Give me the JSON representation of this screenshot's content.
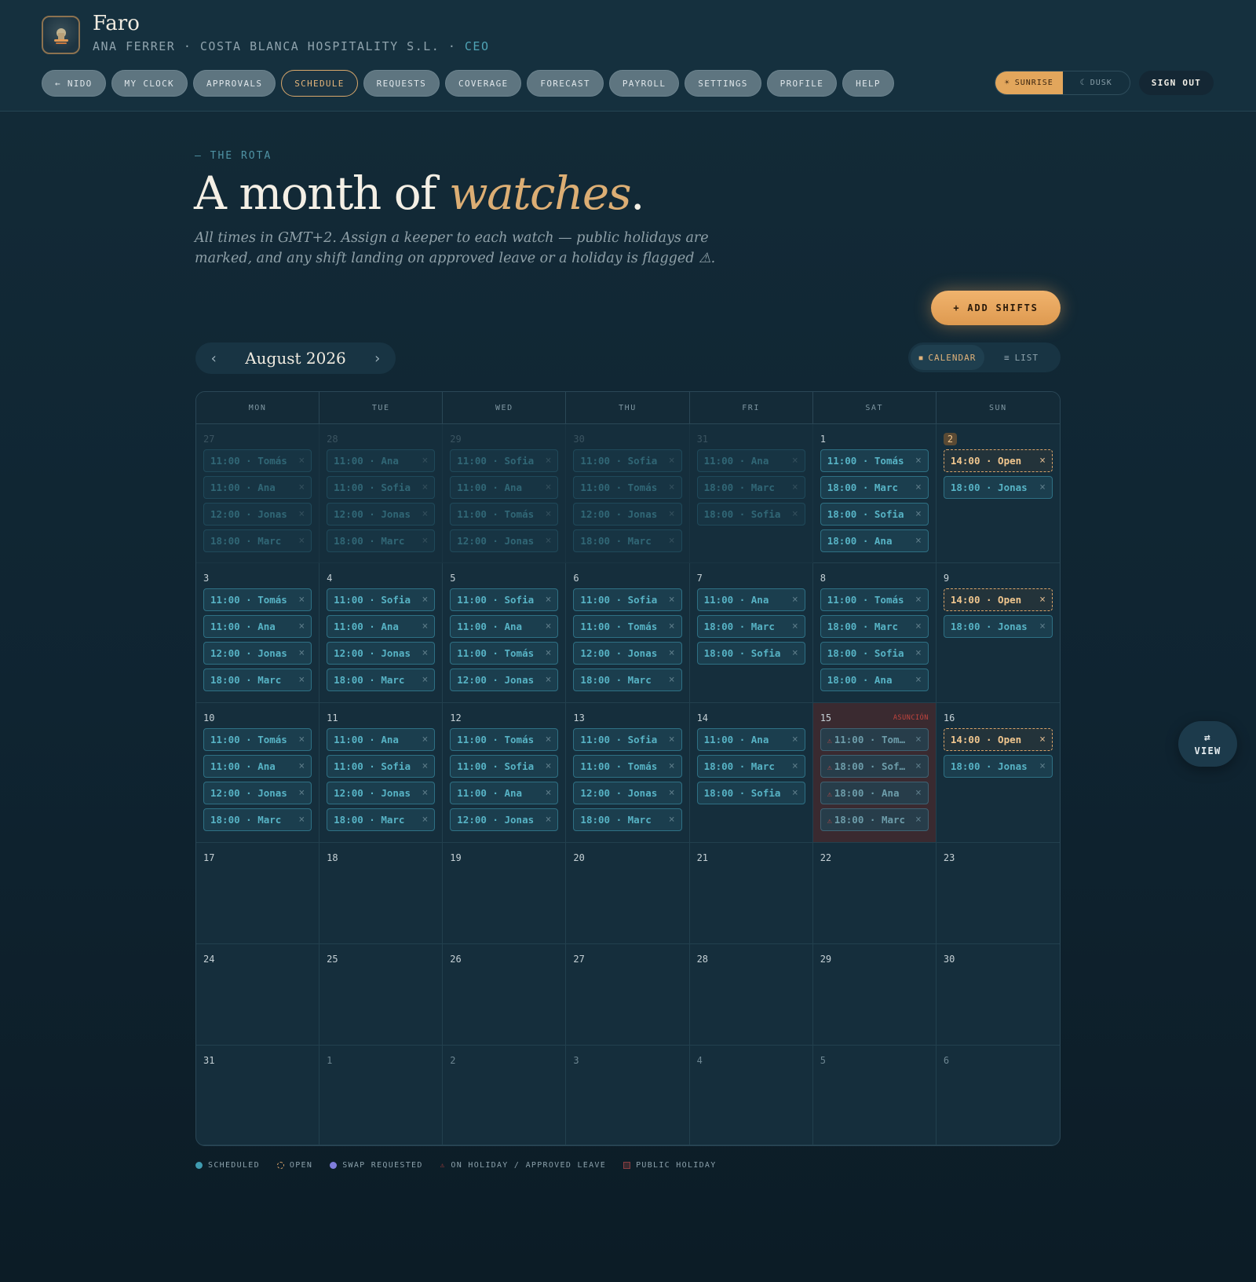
{
  "brand": {
    "name": "Faro",
    "user": "ANA FERRER · COSTA BLANCA HOSPITALITY S.L. · ",
    "role": "CEO"
  },
  "nav": [
    "← NIDO",
    "MY CLOCK",
    "APPROVALS",
    "SCHEDULE",
    "REQUESTS",
    "COVERAGE",
    "FORECAST",
    "PAYROLL",
    "SETTINGS",
    "PROFILE",
    "HELP"
  ],
  "nav_active": "SCHEDULE",
  "theme": {
    "sunrise": "SUNRISE",
    "dusk": "DUSK",
    "active": "sunrise"
  },
  "signout": "SIGN OUT",
  "header": {
    "eyebrow": "— THE ROTA",
    "title_a": "A month of ",
    "title_accent": "watches",
    "title_b": ".",
    "subtitle": "All times in GMT+2. Assign a keeper to each watch — public holidays are marked, and any shift landing on approved leave or a holiday is flagged ⚠."
  },
  "add_shifts": "+ ADD SHIFTS",
  "month": {
    "label": "August 2026",
    "prev": "‹",
    "next": "›"
  },
  "view_toggle": {
    "calendar": "CALENDAR",
    "list": "LIST",
    "active": "calendar"
  },
  "weekdays": [
    "MON",
    "TUE",
    "WED",
    "THU",
    "FRI",
    "SAT",
    "SUN"
  ],
  "weeks": [
    [
      {
        "day": "27",
        "other": true,
        "dim": true,
        "shifts": [
          [
            "11:00 · Tomás"
          ],
          [
            "11:00 · Ana"
          ],
          [
            "12:00 · Jonas"
          ],
          [
            "18:00 · Marc"
          ]
        ]
      },
      {
        "day": "28",
        "other": true,
        "dim": true,
        "shifts": [
          [
            "11:00 · Ana"
          ],
          [
            "11:00 · Sofia"
          ],
          [
            "12:00 · Jonas"
          ],
          [
            "18:00 · Marc"
          ]
        ]
      },
      {
        "day": "29",
        "other": true,
        "dim": true,
        "shifts": [
          [
            "11:00 · Sofia"
          ],
          [
            "11:00 · Ana"
          ],
          [
            "11:00 · Tomás"
          ],
          [
            "12:00 · Jonas"
          ]
        ]
      },
      {
        "day": "30",
        "other": true,
        "dim": true,
        "shifts": [
          [
            "11:00 · Sofia"
          ],
          [
            "11:00 · Tomás"
          ],
          [
            "12:00 · Jonas"
          ],
          [
            "18:00 · Marc"
          ]
        ]
      },
      {
        "day": "31",
        "other": true,
        "dim": true,
        "shifts": [
          [
            "11:00 · Ana"
          ],
          [
            "18:00 · Marc"
          ],
          [
            "18:00 · Sofia"
          ]
        ]
      },
      {
        "day": "1",
        "shifts": [
          [
            "11:00 · Tomás"
          ],
          [
            "18:00 · Marc"
          ],
          [
            "18:00 · Sofia"
          ],
          [
            "18:00 · Ana"
          ]
        ]
      },
      {
        "day": "2",
        "today": true,
        "shifts": [
          [
            "14:00 · Open",
            "open"
          ],
          [
            "18:00 · Jonas"
          ]
        ]
      }
    ],
    [
      {
        "day": "3",
        "shifts": [
          [
            "11:00 · Tomás"
          ],
          [
            "11:00 · Ana"
          ],
          [
            "12:00 · Jonas"
          ],
          [
            "18:00 · Marc"
          ]
        ]
      },
      {
        "day": "4",
        "shifts": [
          [
            "11:00 · Sofia"
          ],
          [
            "11:00 · Ana"
          ],
          [
            "12:00 · Jonas"
          ],
          [
            "18:00 · Marc"
          ]
        ]
      },
      {
        "day": "5",
        "shifts": [
          [
            "11:00 · Sofia"
          ],
          [
            "11:00 · Ana"
          ],
          [
            "11:00 · Tomás"
          ],
          [
            "12:00 · Jonas"
          ]
        ]
      },
      {
        "day": "6",
        "shifts": [
          [
            "11:00 · Sofia"
          ],
          [
            "11:00 · Tomás"
          ],
          [
            "12:00 · Jonas"
          ],
          [
            "18:00 · Marc"
          ]
        ]
      },
      {
        "day": "7",
        "shifts": [
          [
            "11:00 · Ana"
          ],
          [
            "18:00 · Marc"
          ],
          [
            "18:00 · Sofia"
          ]
        ]
      },
      {
        "day": "8",
        "shifts": [
          [
            "11:00 · Tomás"
          ],
          [
            "18:00 · Marc"
          ],
          [
            "18:00 · Sofia"
          ],
          [
            "18:00 · Ana"
          ]
        ]
      },
      {
        "day": "9",
        "shifts": [
          [
            "14:00 · Open",
            "open"
          ],
          [
            "18:00 · Jonas"
          ]
        ]
      }
    ],
    [
      {
        "day": "10",
        "shifts": [
          [
            "11:00 · Tomás"
          ],
          [
            "11:00 · Ana"
          ],
          [
            "12:00 · Jonas"
          ],
          [
            "18:00 · Marc"
          ]
        ]
      },
      {
        "day": "11",
        "shifts": [
          [
            "11:00 · Ana"
          ],
          [
            "11:00 · Sofia"
          ],
          [
            "12:00 · Jonas"
          ],
          [
            "18:00 · Marc"
          ]
        ]
      },
      {
        "day": "12",
        "shifts": [
          [
            "11:00 · Tomás"
          ],
          [
            "11:00 · Sofia"
          ],
          [
            "11:00 · Ana"
          ],
          [
            "12:00 · Jonas"
          ]
        ]
      },
      {
        "day": "13",
        "shifts": [
          [
            "11:00 · Sofia"
          ],
          [
            "11:00 · Tomás"
          ],
          [
            "12:00 · Jonas"
          ],
          [
            "18:00 · Marc"
          ]
        ]
      },
      {
        "day": "14",
        "shifts": [
          [
            "11:00 · Ana"
          ],
          [
            "18:00 · Marc"
          ],
          [
            "18:00 · Sofia"
          ]
        ]
      },
      {
        "day": "15",
        "holiday": "ASUNCIÓN",
        "shifts": [
          [
            "11:00 · Tom…",
            "flag"
          ],
          [
            "18:00 · Sof…",
            "flag"
          ],
          [
            "18:00 · Ana",
            "flag"
          ],
          [
            "18:00 · Marc",
            "flag"
          ]
        ]
      },
      {
        "day": "16",
        "shifts": [
          [
            "14:00 · Open",
            "open"
          ],
          [
            "18:00 · Jonas"
          ]
        ]
      }
    ],
    [
      {
        "day": "17",
        "shifts": []
      },
      {
        "day": "18",
        "shifts": []
      },
      {
        "day": "19",
        "shifts": []
      },
      {
        "day": "20",
        "shifts": []
      },
      {
        "day": "21",
        "shifts": []
      },
      {
        "day": "22",
        "shifts": []
      },
      {
        "day": "23",
        "shifts": []
      }
    ],
    [
      {
        "day": "24",
        "shifts": []
      },
      {
        "day": "25",
        "shifts": []
      },
      {
        "day": "26",
        "shifts": []
      },
      {
        "day": "27",
        "shifts": []
      },
      {
        "day": "28",
        "shifts": []
      },
      {
        "day": "29",
        "shifts": []
      },
      {
        "day": "30",
        "shifts": []
      }
    ],
    [
      {
        "day": "31",
        "shifts": []
      },
      {
        "day": "1",
        "other": true,
        "shifts": []
      },
      {
        "day": "2",
        "other": true,
        "shifts": []
      },
      {
        "day": "3",
        "other": true,
        "shifts": []
      },
      {
        "day": "4",
        "other": true,
        "shifts": []
      },
      {
        "day": "5",
        "other": true,
        "shifts": []
      },
      {
        "day": "6",
        "other": true,
        "shifts": []
      }
    ]
  ],
  "legend": [
    {
      "label": "SCHEDULED",
      "kind": "scheduled"
    },
    {
      "label": "OPEN",
      "kind": "open"
    },
    {
      "label": "SWAP REQUESTED",
      "kind": "swap"
    },
    {
      "label": "ON HOLIDAY / APPROVED LEAVE",
      "kind": "leave"
    },
    {
      "label": "PUBLIC HOLIDAY",
      "kind": "holiday"
    }
  ],
  "colors": {
    "scheduled": "#3f9bb0",
    "open": "#d8a36a",
    "swap": "#7f7ddc",
    "leave": "#c2443e",
    "holiday": "#8a3e42",
    "accent": "#dcae74"
  },
  "view_fab": "VIEW"
}
